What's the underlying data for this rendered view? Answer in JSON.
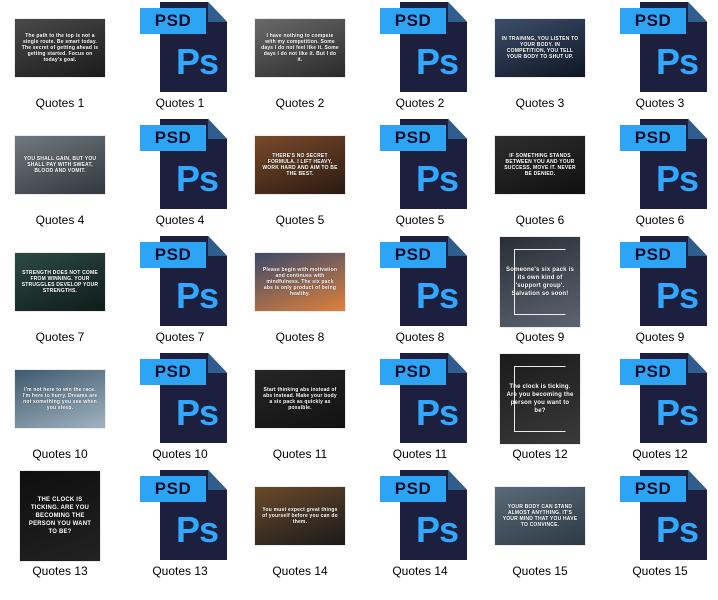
{
  "items": [
    {
      "name": "Quotes 1",
      "type": "image",
      "orient": "land",
      "colors": [
        "#1b1b1b",
        "#4a4a4a"
      ],
      "text": "The path to the top is not a single route. Be smart today. The secret of getting ahead is getting started. Focus on today's goal."
    },
    {
      "name": "Quotes 1",
      "type": "psd"
    },
    {
      "name": "Quotes 2",
      "type": "image",
      "orient": "land",
      "colors": [
        "#2a2a2a",
        "#6a6a6a"
      ],
      "text": "I have nothing to compete with my competition. Some days I do not feel like it. Some days I do not like it. But I do it."
    },
    {
      "name": "Quotes 2",
      "type": "psd"
    },
    {
      "name": "Quotes 3",
      "type": "image",
      "orient": "land",
      "colors": [
        "#0e1624",
        "#3c4f6b"
      ],
      "text": "IN TRAINING, YOU LISTEN TO YOUR BODY. IN COMPETITION, YOU TELL YOUR BODY TO SHUT UP."
    },
    {
      "name": "Quotes 3",
      "type": "psd"
    },
    {
      "name": "Quotes 4",
      "type": "image",
      "orient": "land",
      "colors": [
        "#31383e",
        "#70797f"
      ],
      "text": "YOU SHALL GAIN, BUT YOU SHALL PAY WITH SWEAT, BLOOD AND VOMIT."
    },
    {
      "name": "Quotes 4",
      "type": "psd"
    },
    {
      "name": "Quotes 5",
      "type": "image",
      "orient": "land",
      "colors": [
        "#2a1a12",
        "#7a4a2a"
      ],
      "text": "THERE'S NO SECRET FORMULA. I LIFT HEAVY, WORK HARD AND AIM TO BE THE BEST."
    },
    {
      "name": "Quotes 5",
      "type": "psd"
    },
    {
      "name": "Quotes 6",
      "type": "image",
      "orient": "land",
      "colors": [
        "#101010",
        "#2e2e2e"
      ],
      "text": "IF SOMETHING STANDS BETWEEN YOU AND YOUR SUCCESS, MOVE IT. NEVER BE DENIED."
    },
    {
      "name": "Quotes 6",
      "type": "psd"
    },
    {
      "name": "Quotes 7",
      "type": "image",
      "orient": "land",
      "colors": [
        "#0f1c1a",
        "#2c4a44"
      ],
      "text": "STRENGTH DOES NOT COME FROM WINNING. YOUR STRUGGLES DEVELOP YOUR STRENGTHS."
    },
    {
      "name": "Quotes 7",
      "type": "psd"
    },
    {
      "name": "Quotes 8",
      "type": "image",
      "orient": "land",
      "colors": [
        "#e0803a",
        "#3b4a6b"
      ],
      "text": "Please begin with motivation and continues with mindfulness. The six pack abs is only product of being healthy."
    },
    {
      "name": "Quotes 8",
      "type": "psd"
    },
    {
      "name": "Quotes 9",
      "type": "image",
      "orient": "port",
      "colors": [
        "#5b6470",
        "#2a2f36"
      ],
      "text": "Someone's six pack is its own kind of 'support group'. Salvation so soon!"
    },
    {
      "name": "Quotes 9",
      "type": "psd"
    },
    {
      "name": "Quotes 10",
      "type": "image",
      "orient": "land",
      "colors": [
        "#9fb2c0",
        "#3f5a6e"
      ],
      "text": "I'm not here to win the race. I'm here to hurry. Dreams are not something you see when you sleep."
    },
    {
      "name": "Quotes 10",
      "type": "psd"
    },
    {
      "name": "Quotes 11",
      "type": "image",
      "orient": "land",
      "colors": [
        "#121212",
        "#262626"
      ],
      "text": "Start thinking abs instead of abs instead. Make your body a six pack as quickly as possible."
    },
    {
      "name": "Quotes 11",
      "type": "psd"
    },
    {
      "name": "Quotes 12",
      "type": "image",
      "orient": "port",
      "colors": [
        "#3a3a3a",
        "#1a1a1a"
      ],
      "text": "The clock is ticking. Are you becoming the person you want to be?"
    },
    {
      "name": "Quotes 12",
      "type": "psd"
    },
    {
      "name": "Quotes 13",
      "type": "image",
      "orient": "port",
      "colors": [
        "#222222",
        "#0e0e0e"
      ],
      "text": "THE CLOCK IS TICKING. ARE YOU BECOMING THE PERSON YOU WANT TO BE?"
    },
    {
      "name": "Quotes 13",
      "type": "psd"
    },
    {
      "name": "Quotes 14",
      "type": "image",
      "orient": "land",
      "colors": [
        "#1a1a1a",
        "#6a4a2a"
      ],
      "text": "You must expect great things of yourself before you can do them."
    },
    {
      "name": "Quotes 14",
      "type": "psd"
    },
    {
      "name": "Quotes 15",
      "type": "image",
      "orient": "land",
      "colors": [
        "#2c3a45",
        "#5a6a78"
      ],
      "text": "YOUR BODY CAN STAND ALMOST ANYTHING. IT'S YOUR MIND THAT YOU HAVE TO CONVINCE."
    },
    {
      "name": "Quotes 15",
      "type": "psd"
    }
  ],
  "psd_icon": {
    "banner_text": "PSD",
    "glyph_text": "Ps",
    "colors": {
      "page": "#1c1f3e",
      "banner": "#2ea5f4",
      "glyph": "#31a8ff"
    }
  }
}
